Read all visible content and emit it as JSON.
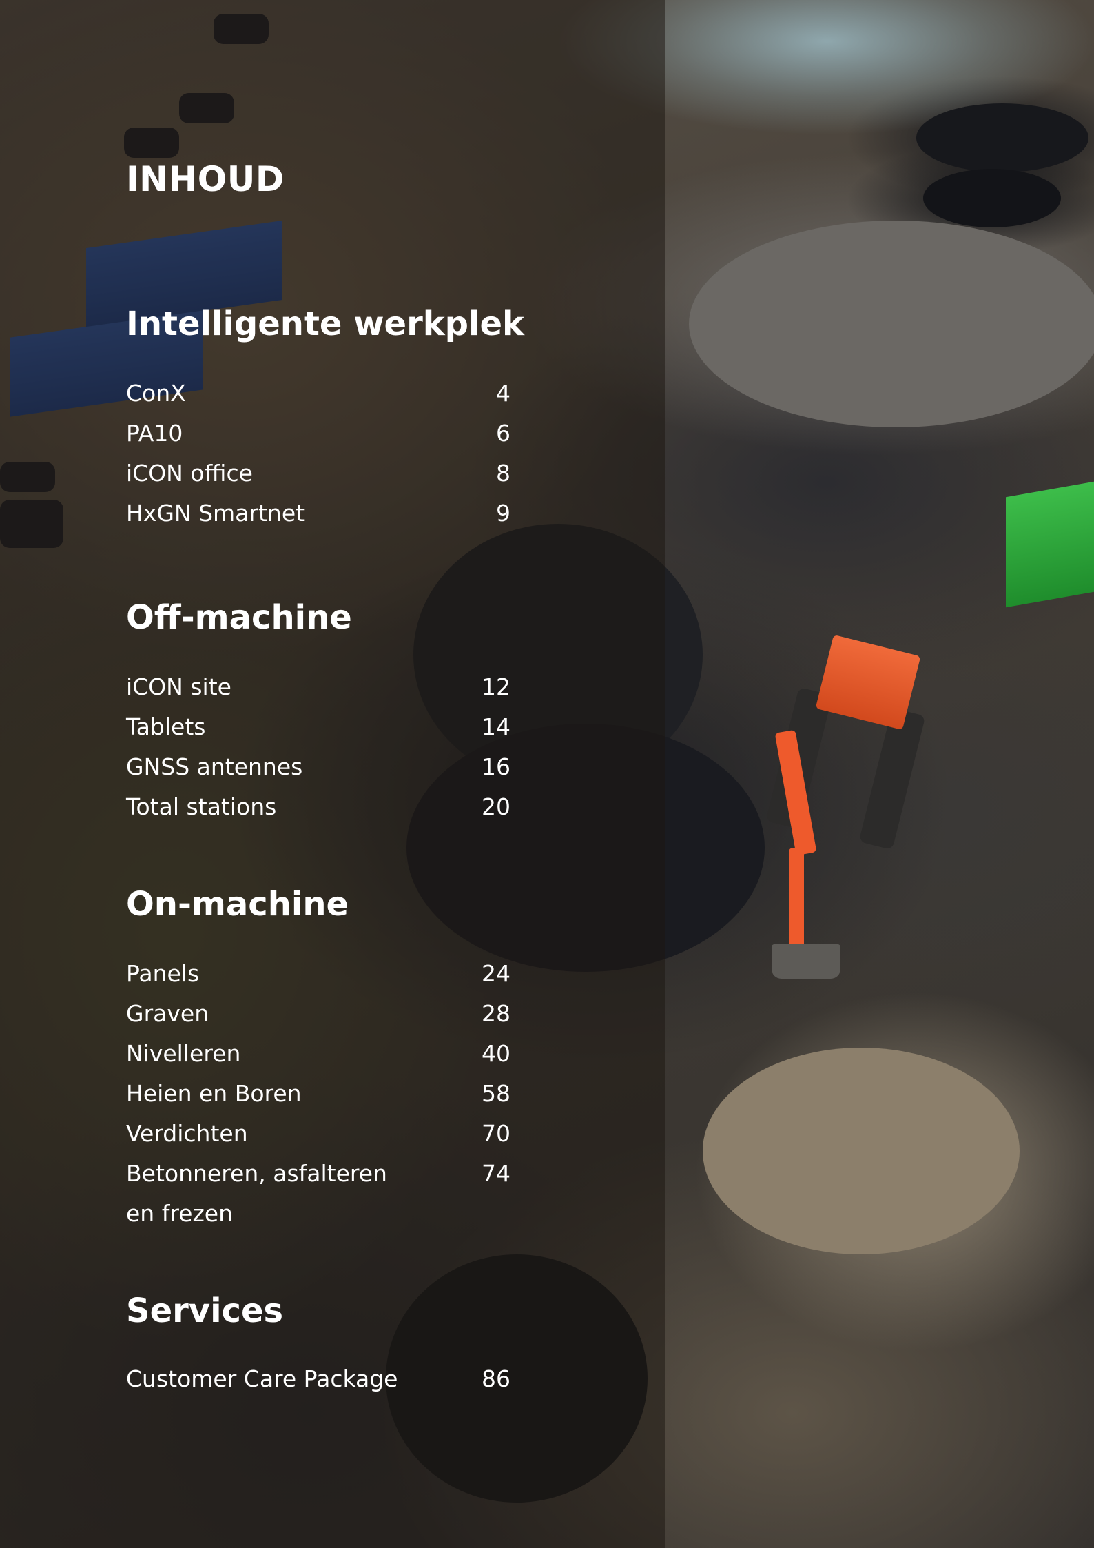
{
  "title": "INHOUD",
  "sections": [
    {
      "heading": "Intelligente werkplek",
      "items": [
        {
          "label": "ConX",
          "page": "4"
        },
        {
          "label": "PA10",
          "page": "6"
        },
        {
          "label": "iCON office",
          "page": "8"
        },
        {
          "label": "HxGN Smartnet",
          "page": "9"
        }
      ]
    },
    {
      "heading": "Off-machine",
      "items": [
        {
          "label": "iCON site",
          "page": "12"
        },
        {
          "label": "Tablets",
          "page": "14"
        },
        {
          "label": "GNSS antennes",
          "page": "16"
        },
        {
          "label": "Total stations",
          "page": "20"
        }
      ]
    },
    {
      "heading": "On-machine",
      "items": [
        {
          "label": "Panels",
          "page": "24"
        },
        {
          "label": "Graven",
          "page": "28"
        },
        {
          "label": "Nivelleren",
          "page": "40"
        },
        {
          "label": "Heien en Boren",
          "page": "58"
        },
        {
          "label": "Verdichten",
          "page": "70"
        },
        {
          "label": "Betonneren, asfalteren en frezen",
          "page": "74"
        }
      ]
    },
    {
      "heading": "Services",
      "items": [
        {
          "label": "Customer Care Package",
          "page": "86"
        }
      ]
    }
  ]
}
